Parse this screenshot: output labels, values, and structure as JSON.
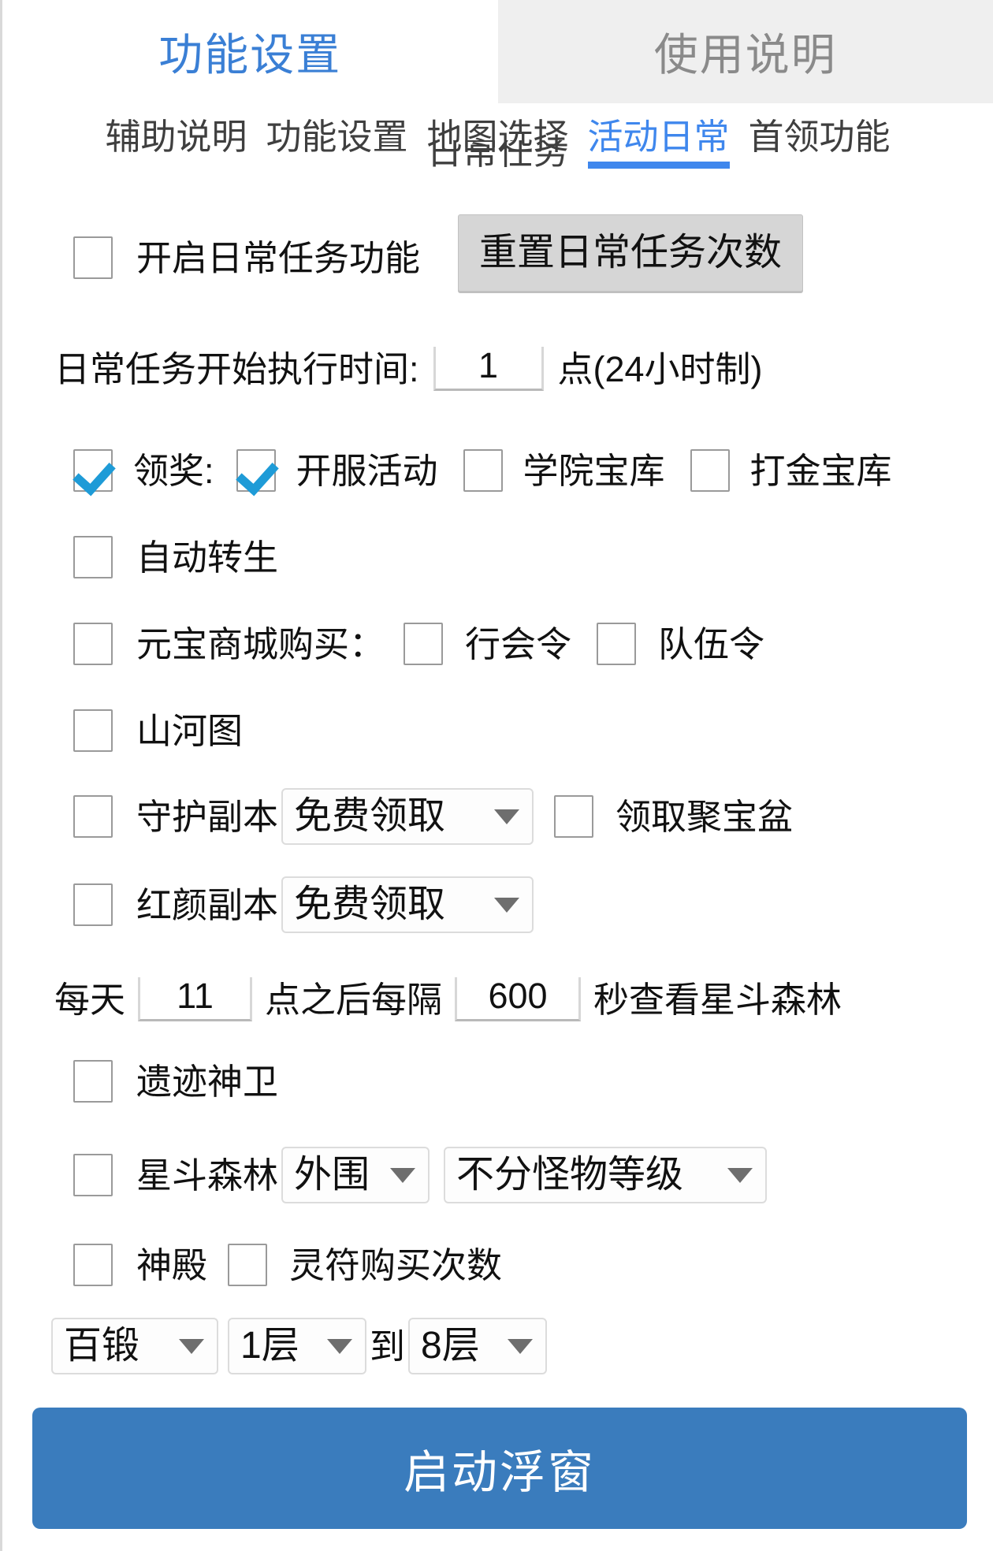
{
  "top_tabs": [
    {
      "label": "功能设置",
      "active": true
    },
    {
      "label": "使用说明",
      "active": false
    }
  ],
  "sub_tabs": [
    {
      "label": "辅助说明",
      "active": false
    },
    {
      "label": "功能设置",
      "active": false
    },
    {
      "label": "地图选择",
      "active": false
    },
    {
      "label": "活动日常",
      "active": true
    },
    {
      "label": "首领功能",
      "active": false
    }
  ],
  "section_title_clipped": "日常任务",
  "rows": {
    "enable_daily": {
      "checkbox_checked": false,
      "label": "开启日常任务功能",
      "button_label": "重置日常任务次数"
    },
    "start_time": {
      "prefix": "日常任务开始执行时间:",
      "value": "1",
      "suffix": "点(24小时制)"
    },
    "claim": {
      "main_checked": true,
      "main_label": "领奖:",
      "items": [
        {
          "label": "开服活动",
          "checked": true
        },
        {
          "label": "学院宝库",
          "checked": false
        },
        {
          "label": "打金宝库",
          "checked": false
        }
      ]
    },
    "auto_rebirth": {
      "label": "自动转生",
      "checked": false
    },
    "yuanbao_shop": {
      "main_label": "元宝商城购买：",
      "main_checked": false,
      "items": [
        {
          "label": "行会令",
          "checked": false
        },
        {
          "label": "队伍令",
          "checked": false
        }
      ]
    },
    "shanhetu": {
      "label": "山河图",
      "checked": false
    },
    "guard_dungeon": {
      "checked": false,
      "label": "守护副本",
      "select_value": "免费领取",
      "extra_checkbox_checked": false,
      "extra_label": "领取聚宝盆"
    },
    "hongyan_dungeon": {
      "checked": false,
      "label": "红颜副本",
      "select_value": "免费领取"
    },
    "star_forest_timer": {
      "p1": "每天",
      "hour_value": "11",
      "p2": "点之后每隔",
      "interval_value": "600",
      "p3": "秒查看星斗森林"
    },
    "relic_guard": {
      "label": "遗迹神卫",
      "checked": false
    },
    "star_forest": {
      "checked": false,
      "label": "星斗森林",
      "area_value": "外围",
      "level_value": "不分怪物等级"
    },
    "temple": {
      "checked": false,
      "label": "神殿",
      "extra_checked": false,
      "extra_label": "灵符购买次数"
    },
    "floor_range": {
      "mode_value": "百锻",
      "from_value": "1层",
      "to_text": "到",
      "to_value": "8层"
    }
  },
  "footer": {
    "start_float_window": "启动浮窗"
  },
  "colors": {
    "accent_blue": "#3a7fd5",
    "tab_active_blue": "#3f87ed",
    "check_blue": "#1e9bd7",
    "primary_button": "#3a7cbd",
    "inactive_tab_bg": "#efefef",
    "inactive_tab_text": "#8a8a8a"
  },
  "icons": {
    "caret": "chevron-down-icon",
    "check": "check-icon"
  }
}
